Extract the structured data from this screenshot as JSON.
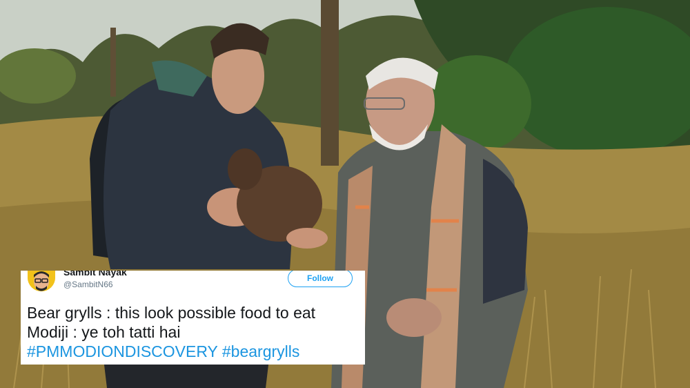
{
  "tweet": {
    "display_name": "Sambit Nayak",
    "handle": "@SambitN66",
    "follow_label": "Follow",
    "lines": [
      "Bear grylls : this look possible food to eat",
      "Modiji : ye toh tatti hai"
    ],
    "hashtags": "#PMMODIONDISCOVERY #beargrylls"
  },
  "colors": {
    "follow_blue": "#1da1f2",
    "hashtag_blue": "#1b95e0",
    "avatar_yellow": "#f2c21b"
  },
  "icons": [
    "avatar"
  ]
}
